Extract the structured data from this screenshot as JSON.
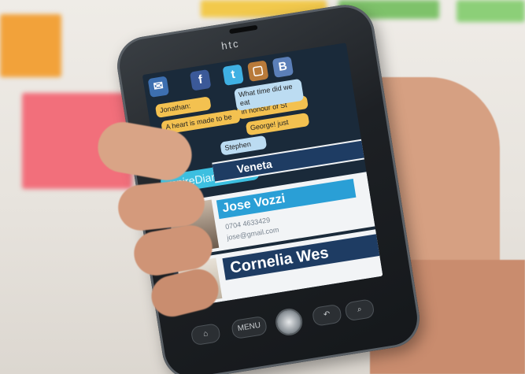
{
  "phone": {
    "brand": "htc",
    "keys": {
      "home": "⌂",
      "menu": "MENU",
      "back": "↶",
      "search": "⌕"
    }
  },
  "screen": {
    "icons": [
      {
        "name": "mail-icon",
        "glyph": "✉",
        "color": "#3d6fb0"
      },
      {
        "name": "facebook-icon",
        "glyph": "f",
        "color": "#3b5998"
      },
      {
        "name": "twitter-icon",
        "glyph": "t",
        "color": "#3fb0e3"
      },
      {
        "name": "chat-icon",
        "glyph": "▢",
        "color": "#b87a3a"
      },
      {
        "name": "blogger-icon",
        "glyph": "B",
        "color": "#5b7fb8"
      }
    ],
    "bubbles": {
      "b1": "Jonathan:",
      "b2": "A heart is made to be",
      "b3": "in honour of St",
      "b4": "George! just",
      "b5": "What time did we eat",
      "b6": "Stephen"
    },
    "teal_bubble": "mpireDiaries day!",
    "contacts": [
      {
        "name": "Veneta"
      },
      {
        "name": "Jose Vozzi",
        "phone": "0704 4633429",
        "email": "jose@gmail.com"
      },
      {
        "name": "Cornelia Wes"
      }
    ]
  }
}
